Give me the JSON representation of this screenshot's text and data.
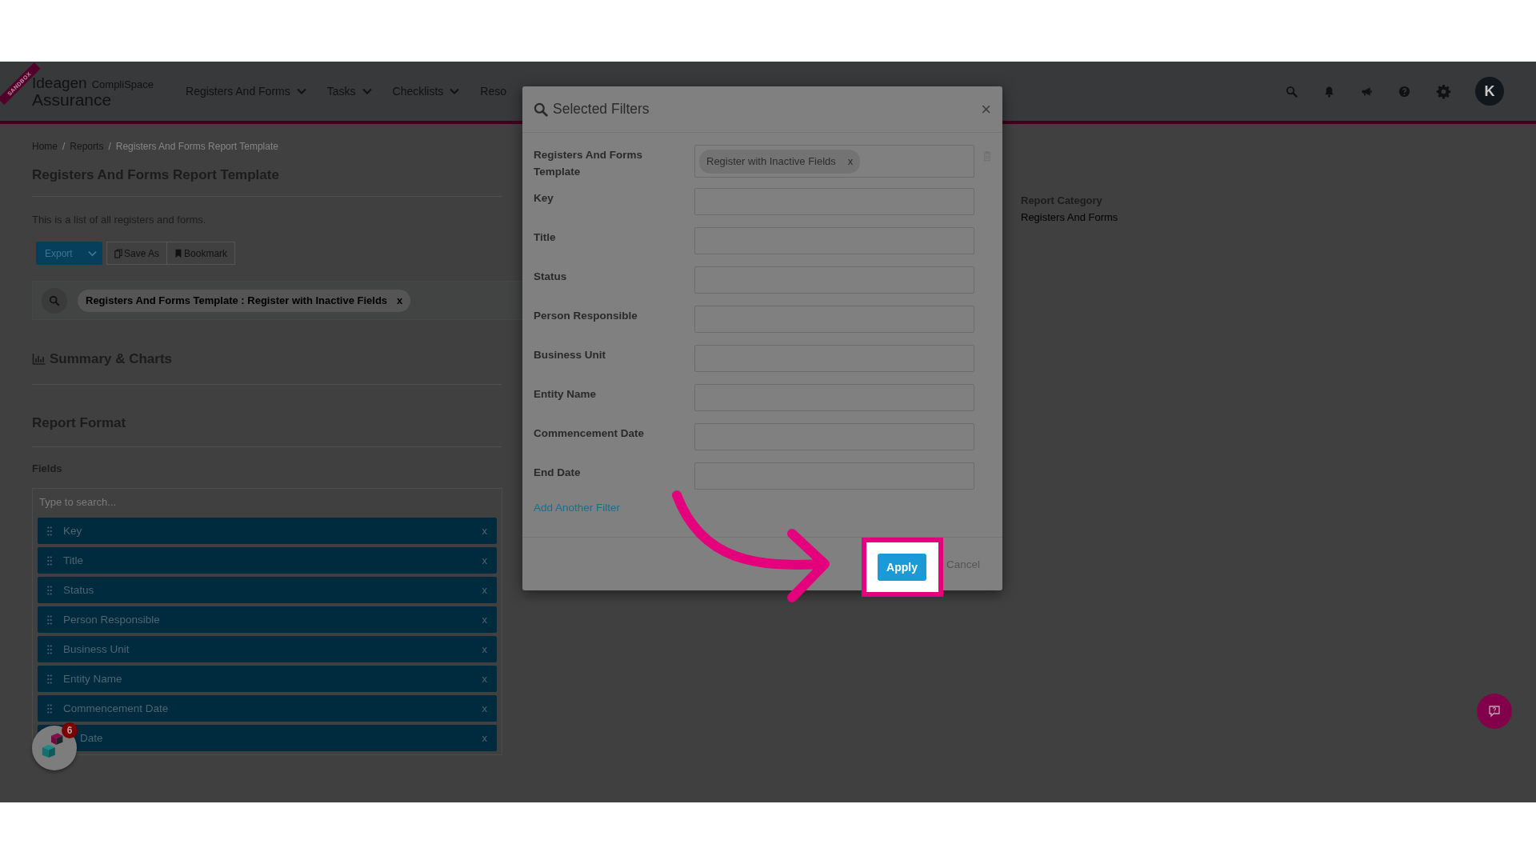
{
  "header": {
    "ribbon": "SANDBOX",
    "logo": {
      "brand": "Ideagen",
      "product": "CompliSpace",
      "suite": "Assurance"
    },
    "nav": [
      {
        "label": "Registers And Forms",
        "dropdown": true
      },
      {
        "label": "Tasks",
        "dropdown": true
      },
      {
        "label": "Checklists",
        "dropdown": true
      },
      {
        "label": "Reso",
        "dropdown": false
      }
    ],
    "avatar": "K"
  },
  "breadcrumb": {
    "separator": "/",
    "items": [
      {
        "label": "Home",
        "current": false
      },
      {
        "label": "Reports",
        "current": false
      },
      {
        "label": "Registers And Forms Report Template",
        "current": true
      }
    ]
  },
  "page": {
    "title": "Registers And Forms Report Template",
    "description": "This is a list of all registers and forms.",
    "actions": {
      "export": "Export",
      "save_as": "Save As",
      "bookmark": "Bookmark"
    },
    "filter_chip": {
      "text": "Registers And Forms Template : Register with Inactive Fields",
      "remove": "x"
    },
    "summary_heading": "Summary & Charts",
    "format_heading": "Report Format",
    "fields_label": "Fields",
    "fields_search": {
      "placeholder": "Type to search..."
    },
    "fields": [
      {
        "label": "Key",
        "remove": "x",
        "partly_covered": false
      },
      {
        "label": "Title",
        "remove": "x",
        "partly_covered": false
      },
      {
        "label": "Status",
        "remove": "x",
        "partly_covered": false
      },
      {
        "label": "Person Responsible",
        "remove": "x",
        "partly_covered": false
      },
      {
        "label": "Business Unit",
        "remove": "x",
        "partly_covered": false
      },
      {
        "label": "Entity Name",
        "remove": "x",
        "partly_covered": false
      },
      {
        "label": "Commencement Date",
        "remove": "x",
        "partly_covered": false
      },
      {
        "label": "Date",
        "remove": "x",
        "partly_covered": true
      }
    ]
  },
  "report_category": {
    "label": "Report Category",
    "value": "Registers And Forms"
  },
  "widget": {
    "badge": "6"
  },
  "modal": {
    "title": "Selected Filters",
    "close": "×",
    "filters": [
      {
        "label": "Registers And Forms Template",
        "chip": {
          "text": "Register with Inactive Fields",
          "remove": "x"
        }
      },
      {
        "label": "Key"
      },
      {
        "label": "Title"
      },
      {
        "label": "Status"
      },
      {
        "label": "Person Responsible"
      },
      {
        "label": "Business Unit"
      },
      {
        "label": "Entity Name"
      },
      {
        "label": "Commencement Date"
      },
      {
        "label": "End Date"
      }
    ],
    "add_filter": "Add Another Filter",
    "apply": "Apply",
    "cancel": "Cancel"
  }
}
